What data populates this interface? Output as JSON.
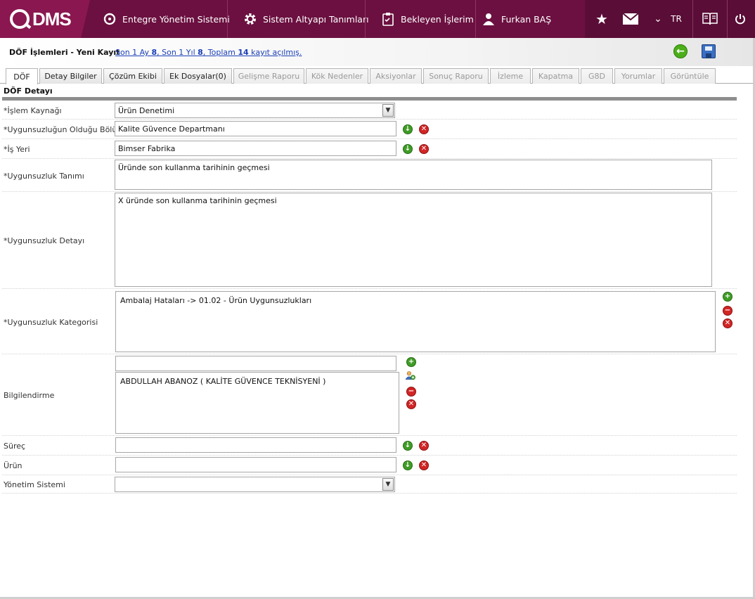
{
  "topbar": {
    "logo_text": "DMS",
    "nav": [
      {
        "label": "Entegre Yönetim Sistemi",
        "icon": "q-circle-icon"
      },
      {
        "label": "Sistem Altyapı Tanımları",
        "icon": "gear-icon"
      },
      {
        "label": "Bekleyen İşlerim",
        "icon": "clipboard-icon"
      },
      {
        "label": "Furkan BAŞ",
        "icon": "user-icon"
      }
    ],
    "language": "TR",
    "icons": [
      "star-icon",
      "mail-icon",
      "chevron-down-icon",
      "help-book-icon",
      "power-icon"
    ],
    "colors": {
      "bar": "#6b1040",
      "logo_bg": "#8a1750"
    }
  },
  "subheader": {
    "title": "DÖF İşlemleri - Yeni Kayıt",
    "summary": {
      "p1": "Son 1 Ay ",
      "n1": "8",
      "p2": ", Son 1 Yıl ",
      "n2": "8",
      "p3": ", Toplam ",
      "n3": "14",
      "p4": " kayıt açılmış."
    }
  },
  "tabs": [
    {
      "label": "DÖF",
      "state": "active"
    },
    {
      "label": "Detay Bilgiler",
      "state": "enabled"
    },
    {
      "label": "Çözüm Ekibi",
      "state": "enabled"
    },
    {
      "label": "Ek Dosyalar(0)",
      "state": "enabled"
    },
    {
      "label": "Gelişme Raporu",
      "state": "disabled"
    },
    {
      "label": "Kök Nedenler",
      "state": "disabled"
    },
    {
      "label": "Aksiyonlar",
      "state": "disabled"
    },
    {
      "label": "Sonuç Raporu",
      "state": "disabled"
    },
    {
      "label": "İzleme",
      "state": "disabled"
    },
    {
      "label": "Kapatma",
      "state": "disabled"
    },
    {
      "label": "G8D",
      "state": "disabled"
    },
    {
      "label": "Yorumlar",
      "state": "disabled"
    },
    {
      "label": "Görüntüle",
      "state": "disabled"
    }
  ],
  "section": {
    "title": "DÖF Detayı"
  },
  "form": {
    "islem_kaynagi": {
      "label": "*İşlem Kaynağı",
      "value": "Ürün Denetimi"
    },
    "bolum": {
      "label": "*Uygunsuzluğun Olduğu Bölüm",
      "value": "Kalite Güvence Departmanı"
    },
    "is_yeri": {
      "label": "*İş Yeri",
      "value": "Bimser Fabrika"
    },
    "tanim": {
      "label": "*Uygunsuzluk Tanımı",
      "value": "Üründe son kullanma tarihinin geçmesi"
    },
    "detay": {
      "label": "*Uygunsuzluk Detayı",
      "value": "X üründe son kullanma tarihinin geçmesi"
    },
    "kategori": {
      "label": "*Uygunsuzluk Kategorisi",
      "value": "Ambalaj Hataları -> 01.02 - Ürün Uygunsuzlukları"
    },
    "bilgilendirme": {
      "label": "Bilgilendirme",
      "search_value": "",
      "value": "ABDULLAH ABANOZ ( KALİTE GÜVENCE TEKNİSYENİ )"
    },
    "surec": {
      "label": "Süreç",
      "value": ""
    },
    "urun": {
      "label": "Ürün",
      "value": ""
    },
    "yonetim_sistemi": {
      "label": "Yönetim Sistemi",
      "value": ""
    }
  },
  "button_glyphs": {
    "down": "↓",
    "remove": "✕",
    "add": "+",
    "minus": "−",
    "back": "←"
  }
}
